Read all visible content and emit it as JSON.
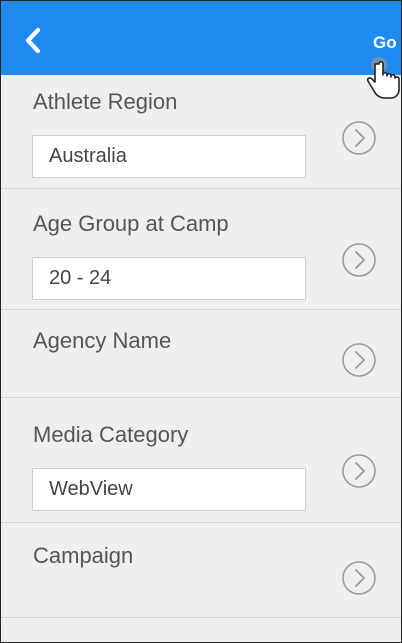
{
  "header": {
    "back_icon": "chevron-left-icon",
    "go_label": "Go",
    "color": "#1f8bf0"
  },
  "fields": [
    {
      "label": "Athlete Region",
      "value": "Australia"
    },
    {
      "label": "Age Group at Camp",
      "value": "20 - 24"
    },
    {
      "label": "Agency Name",
      "value": null
    },
    {
      "label": "Media Category",
      "value": "WebView"
    },
    {
      "label": "Campaign",
      "value": null
    }
  ],
  "row_icon": "circle-chevron-right-icon"
}
